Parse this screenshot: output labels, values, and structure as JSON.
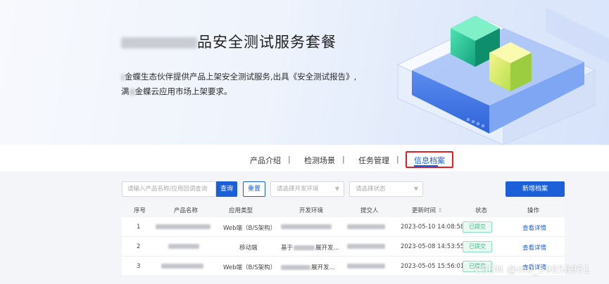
{
  "hero": {
    "title": "品安全测试服务套餐",
    "desc_line1": "金蝶生态伙伴提供产品上架安全测试服务,出具《安全测试报告》,",
    "desc_line2": "金蝶云应用市场上架要求。",
    "desc_line2_prefix": "满"
  },
  "tabs": [
    {
      "label": "产品介绍"
    },
    {
      "label": "检测场景"
    },
    {
      "label": "任务管理"
    },
    {
      "label": "信息档案"
    }
  ],
  "tab_separator": "|",
  "filters": {
    "search_placeholder": "请输入产品名称/应用回调查询",
    "query_label": "查询",
    "reset_label": "重置",
    "env_select_placeholder": "请选择开发环境",
    "status_select_placeholder": "请选择状态",
    "new_label": "新增档案"
  },
  "table": {
    "headers": [
      "序号",
      "产品名称",
      "应用类型",
      "开发环境",
      "提交人",
      "更新时间",
      "状态",
      "操作"
    ],
    "rows": [
      {
        "index": "1",
        "app_type": "Web端（B/S架构）",
        "env_prefix": "",
        "updated": "2023-05-10 14:08:58",
        "status": "已提交",
        "action": "查看详情"
      },
      {
        "index": "2",
        "app_type": "移动端",
        "env_prefix": "基于",
        "env_suffix": "展开发...",
        "updated": "2023-05-08 14:53:55",
        "status": "已提交",
        "action": "查看详情"
      },
      {
        "index": "3",
        "app_type": "Web端（B/S架构）",
        "env_prefix": "",
        "env_suffix": "展开发...",
        "updated": "2023-05-05 15:56:01",
        "status": "已提交",
        "action": "查看详情"
      }
    ]
  },
  "watermark": "CSDN @m0_59856951",
  "colors": {
    "accent": "#1b5fd9",
    "highlight": "#e02020",
    "status_green": "#33c08b"
  }
}
